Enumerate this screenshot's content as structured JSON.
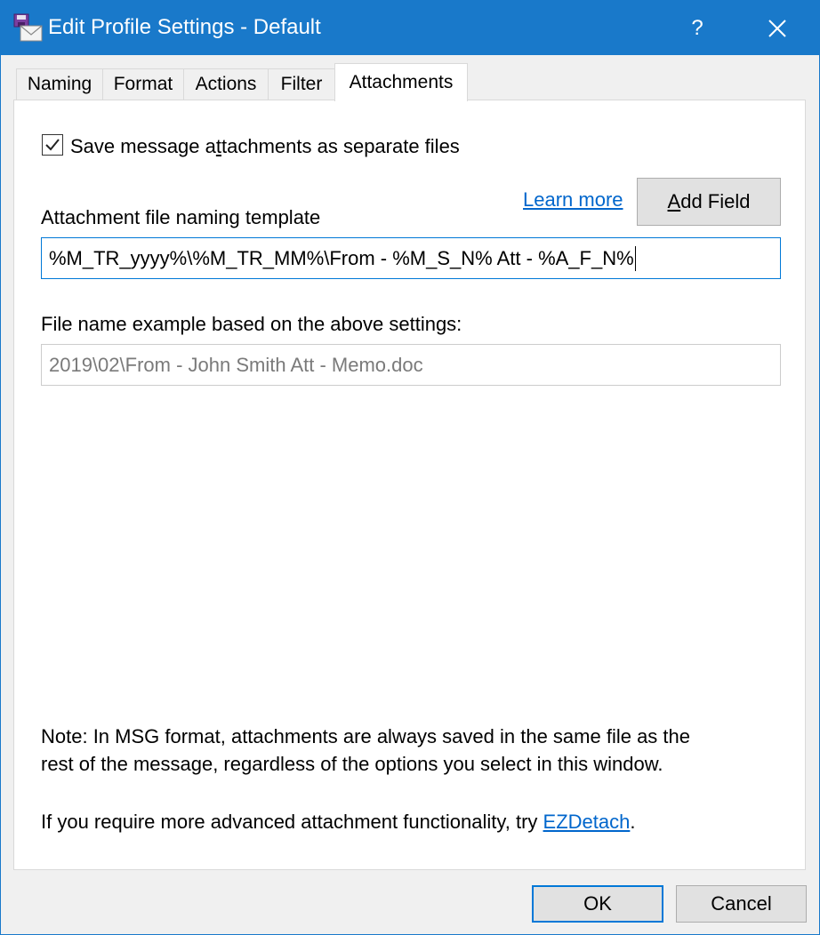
{
  "window": {
    "title": "Edit Profile Settings - Default",
    "help_label": "?",
    "icon": "mail-profile-icon"
  },
  "tabs": [
    {
      "label": "Naming"
    },
    {
      "label": "Format"
    },
    {
      "label": "Actions"
    },
    {
      "label": "Filter"
    },
    {
      "label": "Attachments",
      "selected": true
    }
  ],
  "attachments": {
    "save_separate": {
      "checked": true,
      "label_pre": "Save message a",
      "label_accel": "t",
      "label_post": "tachments as separate files"
    },
    "learn_more": "Learn more",
    "add_field": {
      "accel": "A",
      "rest": "dd Field"
    },
    "template_label": "Attachment file naming template",
    "template_value": "%M_TR_yyyy%\\%M_TR_MM%\\From - %M_S_N% Att - %A_F_N%",
    "example_label": "File name example based on the above settings:",
    "example_value": "2019\\02\\From - John Smith Att - Memo.doc",
    "note_line1": "Note: In MSG format, attachments are always saved in the same file as the",
    "note_line2": "rest of the message, regardless of the options you select in this window.",
    "advanced_text": "If you require more advanced attachment functionality, try ",
    "advanced_link": "EZDetach",
    "advanced_end": "."
  },
  "footer": {
    "ok": "OK",
    "cancel": "Cancel"
  },
  "colors": {
    "titlebar": "#1979ca",
    "link": "#0066cc",
    "focus_border": "#0078d7"
  }
}
